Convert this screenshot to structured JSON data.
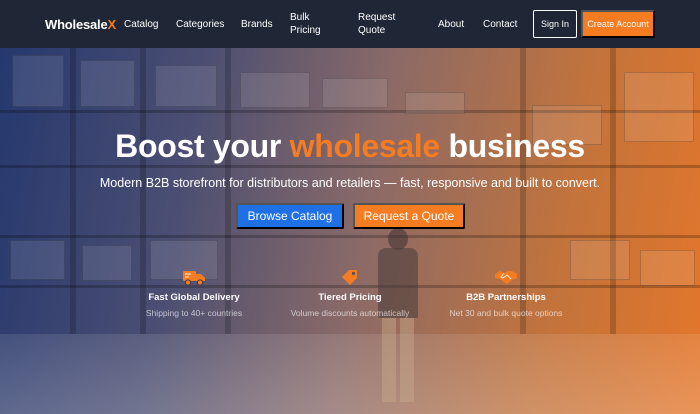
{
  "brand": {
    "name": "Wholesale",
    "accent": "X"
  },
  "nav": {
    "links": [
      "Catalog",
      "Categories",
      "Brands",
      "Bulk Pricing",
      "Request Quote",
      "About",
      "Contact"
    ],
    "sign_in": "Sign In",
    "create_account": "Create Account"
  },
  "hero": {
    "headline_pre": "Boost your ",
    "headline_accent": "wholesale",
    "headline_post": " business",
    "subheadline": "Modern B2B storefront for distributors and retailers — fast, responsive and built to convert.",
    "primary_cta": "Browse Catalog",
    "secondary_cta": "Request a Quote"
  },
  "features": [
    {
      "icon": "truck-icon",
      "title": "Fast Global Delivery",
      "desc": "Shipping to 40+ countries"
    },
    {
      "icon": "tag-icon",
      "title": "Tiered Pricing",
      "desc": "Volume discounts automatically"
    },
    {
      "icon": "handshake-icon",
      "title": "B2B Partnerships",
      "desc": "Net 30 and bulk quote options"
    }
  ],
  "colors": {
    "accent": "#f57c20",
    "primary": "#1f6fe5",
    "nav_bg": "#1f2636"
  }
}
